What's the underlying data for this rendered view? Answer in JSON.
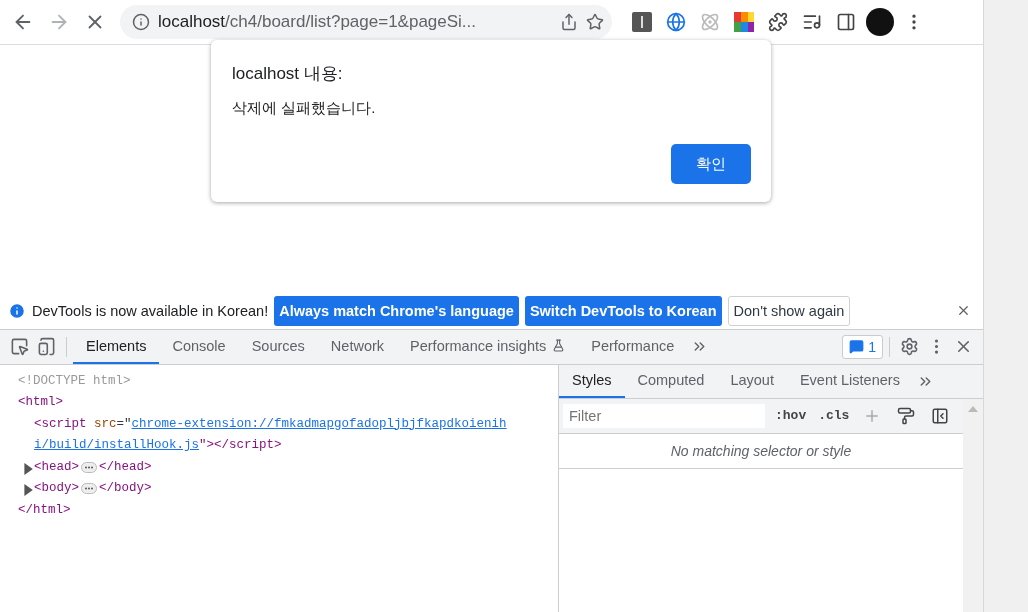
{
  "toolbar": {
    "url_host": "localhost",
    "url_path": "/ch4/board/list?page=1&pageSi..."
  },
  "dialog": {
    "title": "localhost 내용:",
    "message": "삭제에 실패했습니다.",
    "button": "확인"
  },
  "infobar": {
    "message": "DevTools is now available in Korean!",
    "buttons": [
      {
        "label": "Always match Chrome's language",
        "kind": "primary"
      },
      {
        "label": "Switch DevTools to Korean",
        "kind": "primary"
      },
      {
        "label": "Don't show again",
        "kind": "secondary"
      }
    ]
  },
  "devtools": {
    "tabs": [
      {
        "label": "Elements",
        "selected": true
      },
      {
        "label": "Console",
        "selected": false
      },
      {
        "label": "Sources",
        "selected": false
      },
      {
        "label": "Network",
        "selected": false
      },
      {
        "label": "Performance insights",
        "selected": false,
        "experimental": true
      },
      {
        "label": "Performance",
        "selected": false
      }
    ],
    "issues_count": "1",
    "tree": [
      {
        "kind": "doctype",
        "text": "<!DOCTYPE html>"
      },
      {
        "kind": "element",
        "open": "<html>",
        "close": "</html>",
        "expanded": true,
        "children": [
          {
            "kind": "script",
            "tag": "<script",
            "attr_name": "src",
            "equals": "=\"",
            "link_lines": [
              "chrome-extension://fmkadmapgofadopljbjfkapdkoienih",
              "i/build/installHook.js"
            ],
            "end": "\"></script>"
          },
          {
            "kind": "element",
            "open": "<head>",
            "close": "</head>",
            "expanded": false
          },
          {
            "kind": "element",
            "open": "<body>",
            "close": "</body>",
            "expanded": false
          }
        ]
      }
    ],
    "styles_tabs": [
      {
        "label": "Styles",
        "selected": true
      },
      {
        "label": "Computed",
        "selected": false
      },
      {
        "label": "Layout",
        "selected": false
      },
      {
        "label": "Event Listeners",
        "selected": false
      }
    ],
    "filter": {
      "placeholder": "Filter"
    },
    "hov": ":hov",
    "cls": ".cls",
    "empty_message": "No matching selector or style"
  }
}
